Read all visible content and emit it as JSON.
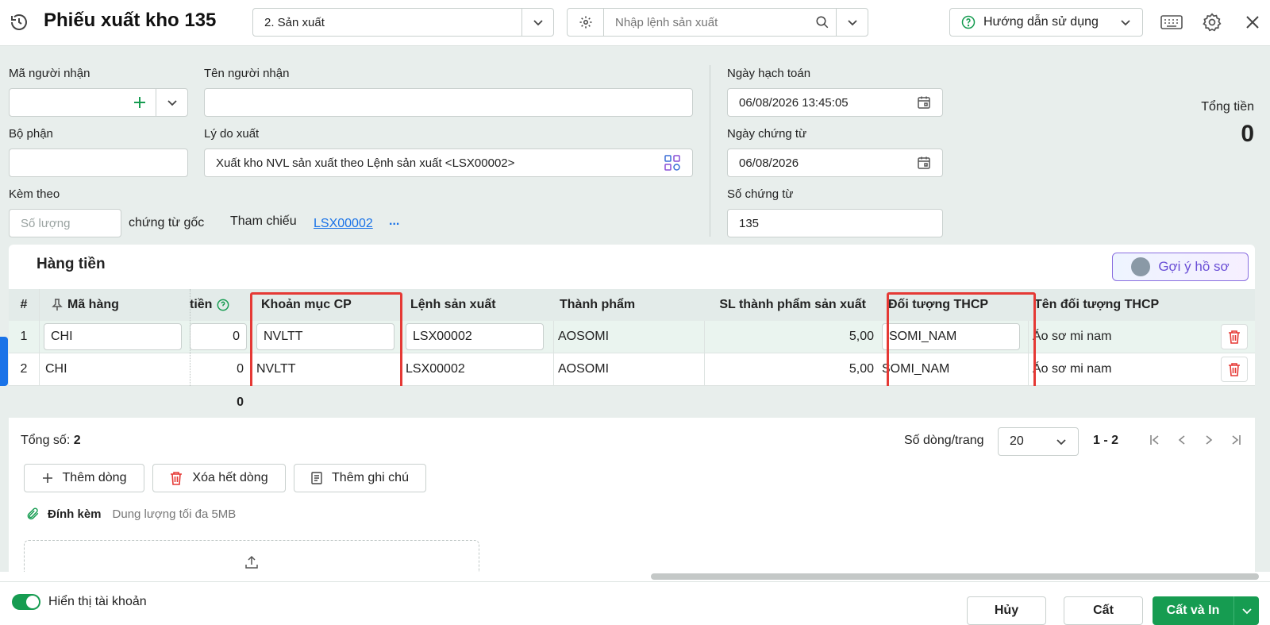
{
  "header": {
    "title": "Phiếu xuất kho 135",
    "type_select": "2. Sản xuất",
    "search_placeholder": "Nhập lệnh sản xuất",
    "help_label": "Hướng dẫn sử dụng"
  },
  "form": {
    "receiver_code_label": "Mã người nhận",
    "receiver_name_label": "Tên người nhận",
    "department_label": "Bộ phận",
    "reason_label": "Lý do xuất",
    "reason_value": "Xuất kho NVL sản xuất theo Lệnh sản xuất <LSX00002>",
    "attach_label": "Kèm theo",
    "qty_placeholder": "Số lượng",
    "origin_doc_label": "chứng từ gốc",
    "reference_label": "Tham chiếu",
    "reference_link": "LSX00002",
    "reference_more": "...",
    "posting_date_label": "Ngày hạch toán",
    "posting_date_value": "06/08/2026 13:45:05",
    "doc_date_label": "Ngày chứng từ",
    "doc_date_value": "06/08/2026",
    "doc_no_label": "Số chứng từ",
    "doc_no_value": "135",
    "total_label": "Tổng tiền",
    "total_value": "0"
  },
  "grid": {
    "section_title": "Hàng tiền",
    "suggest_button": "Gợi ý hồ sơ",
    "columns": {
      "idx": "#",
      "item_code": "Mã hàng",
      "amount": "tiền",
      "cost_item": "Khoản mục CP",
      "production_order": "Lệnh sản xuất",
      "product": "Thành phẩm",
      "product_qty": "SL thành phẩm sản xuất",
      "cost_object": "Đối tượng THCP",
      "cost_object_name": "Tên đối tượng THCP"
    },
    "rows": [
      {
        "idx": "1",
        "item_code": "CHI",
        "amount": "0",
        "cost_item": "NVLTT",
        "production_order": "LSX00002",
        "product": "AOSOMI",
        "product_qty": "5,00",
        "cost_object": "SOMI_NAM",
        "cost_object_name": "Áo sơ mi nam"
      },
      {
        "idx": "2",
        "item_code": "CHI",
        "amount": "0",
        "cost_item": "NVLTT",
        "production_order": "LSX00002",
        "product": "AOSOMI",
        "product_qty": "5,00",
        "cost_object": "SOMI_NAM",
        "cost_object_name": "Áo sơ mi nam"
      }
    ],
    "footer_amount_total": "0",
    "total_count_label": "Tổng số:",
    "total_count_value": "2",
    "rows_per_page_label": "Số dòng/trang",
    "rows_per_page_value": "20",
    "page_range": "1 - 2",
    "add_row": "Thêm dòng",
    "delete_all_rows": "Xóa hết dòng",
    "add_note": "Thêm ghi chú"
  },
  "attachment": {
    "label": "Đính kèm",
    "hint": "Dung lượng tối đa 5MB"
  },
  "footer": {
    "show_account_label": "Hiển thị tài khoản",
    "cancel": "Hủy",
    "save": "Cất",
    "save_print": "Cất và In"
  },
  "colors": {
    "accent": "#169c51",
    "highlight_border": "#e53935",
    "link": "#1a73e8",
    "header_row": "#e3ebe9",
    "row1": "#eaf4ef"
  }
}
